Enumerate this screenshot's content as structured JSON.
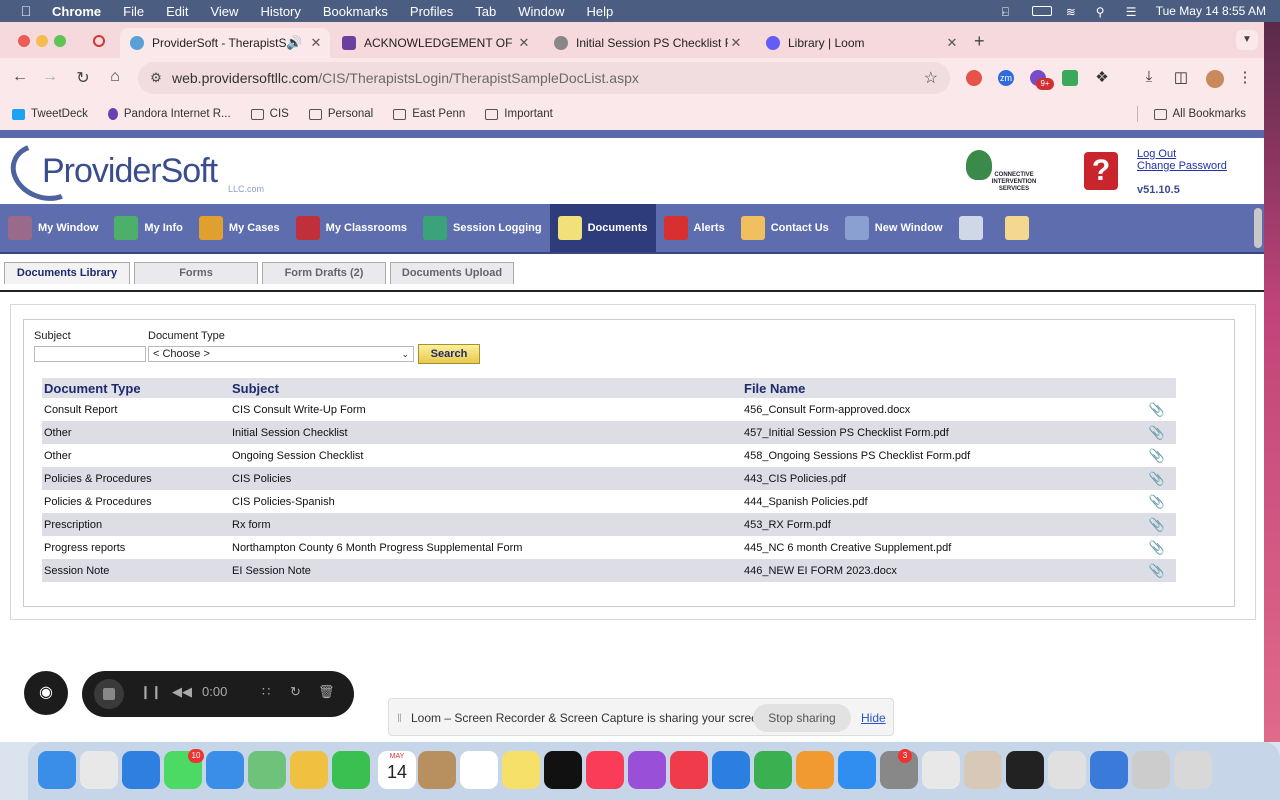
{
  "menubar": {
    "app": "Chrome",
    "items": [
      "File",
      "Edit",
      "View",
      "History",
      "Bookmarks",
      "Profiles",
      "Tab",
      "Window",
      "Help"
    ],
    "clock": "Tue May 14  8:55 AM"
  },
  "tabs": [
    {
      "title": "ProviderSoft - TherapistS",
      "active": true,
      "favicon_color": "#5aa0d8"
    },
    {
      "title": "ACKNOWLEDGEMENT OF RE",
      "active": false,
      "favicon_color": "#6b3fa0"
    },
    {
      "title": "Initial Session PS Checklist F",
      "active": false,
      "favicon_color": "#888888"
    },
    {
      "title": "Library | Loom",
      "active": false,
      "favicon_color": "#625df5"
    }
  ],
  "toolbar": {
    "url_host": "web.providersoftllc.com",
    "url_path": "/CIS/TherapistsLogin/TherapistSampleDocList.aspx",
    "ext_badge": "9+"
  },
  "bookmarks": [
    "TweetDeck",
    "Pandora Internet R...",
    "CIS",
    "Personal",
    "East Penn",
    "Important"
  ],
  "all_bookmarks": "All Bookmarks",
  "header": {
    "logo_text": "ProviderSoft",
    "logo_suffix": "LLC.com",
    "partner_logo_text": "CONNECTIVE INTERVENTION SERVICES",
    "logout": "Log Out",
    "change_password": "Change Password",
    "version": "v51.10.5"
  },
  "nav": [
    {
      "label": "My Window",
      "color": "#9a6a8a"
    },
    {
      "label": "My Info",
      "color": "#4caf6a"
    },
    {
      "label": "My Cases",
      "color": "#e0a030"
    },
    {
      "label": "My Classrooms",
      "color": "#c0303a"
    },
    {
      "label": "Session Logging",
      "color": "#3aa37a"
    },
    {
      "label": "Documents",
      "color": "#f2e07a"
    },
    {
      "label": "Alerts",
      "color": "#d83030"
    },
    {
      "label": "Contact Us",
      "color": "#f0c060"
    },
    {
      "label": "New Window",
      "color": "#8aa0d0"
    },
    {
      "label": "",
      "color": "#d0d8e8"
    },
    {
      "label": "",
      "color": "#f4d890"
    }
  ],
  "subtabs": [
    "Documents Library",
    "Forms",
    "Form Drafts (2)",
    "Documents Upload"
  ],
  "filters": {
    "subject_label": "Subject",
    "subject_value": "",
    "doctype_label": "Document Type",
    "doctype_value": "< Choose >",
    "search_button": "Search"
  },
  "table": {
    "headers": [
      "Document Type",
      "Subject",
      "File Name"
    ],
    "rows": [
      {
        "type": "Consult Report",
        "subject": "CIS Consult Write-Up Form",
        "file": "456_Consult Form-approved.docx"
      },
      {
        "type": "Other",
        "subject": "Initial Session Checklist",
        "file": "457_Initial Session PS Checklist Form.pdf"
      },
      {
        "type": "Other",
        "subject": "Ongoing Session Checklist",
        "file": "458_Ongoing Sessions PS Checklist Form.pdf"
      },
      {
        "type": "Policies & Procedures",
        "subject": "CIS Policies",
        "file": "443_CIS Policies.pdf"
      },
      {
        "type": "Policies & Procedures",
        "subject": "CIS Policies-Spanish",
        "file": "444_Spanish Policies.pdf"
      },
      {
        "type": "Prescription",
        "subject": "Rx form",
        "file": "453_RX Form.pdf"
      },
      {
        "type": "Progress reports",
        "subject": "Northampton County 6 Month Progress Supplemental Form",
        "file": "445_NC 6 month Creative Supplement.pdf"
      },
      {
        "type": "Session Note",
        "subject": "EI Session Note",
        "file": "446_NEW EI FORM 2023.docx"
      }
    ]
  },
  "loom": {
    "timer": "0:00"
  },
  "share_banner": {
    "message": "Loom – Screen Recorder & Screen Capture is sharing your screen.",
    "stop": "Stop sharing",
    "hide": "Hide"
  },
  "dock": {
    "calendar_month": "MAY",
    "calendar_day": "14",
    "badges": [
      "10",
      "3"
    ]
  }
}
